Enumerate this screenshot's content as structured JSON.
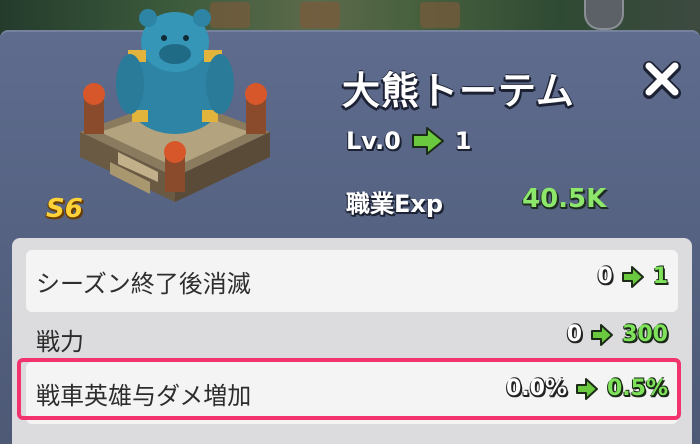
{
  "building": {
    "name": "大熊トーテム",
    "rank": "S6",
    "level_label": "Lv.0",
    "level_next": "1",
    "exp_label": "職業Exp",
    "exp_value": "40.5K"
  },
  "stats": [
    {
      "label": "シーズン終了後消滅",
      "from": "0",
      "to": "1"
    },
    {
      "label": "戦力",
      "from": "0",
      "to": "300"
    },
    {
      "label": "戦車英雄与ダメ増加",
      "from": "0.0%",
      "to": "0.5%"
    }
  ],
  "colors": {
    "panel": "#5a6789",
    "accent_green": "#7ee35b",
    "rank_gold": "#ffd23a",
    "highlight": "#f2336e"
  },
  "icons": [
    "close-icon",
    "arrow-right-icon",
    "bear-totem-icon"
  ]
}
